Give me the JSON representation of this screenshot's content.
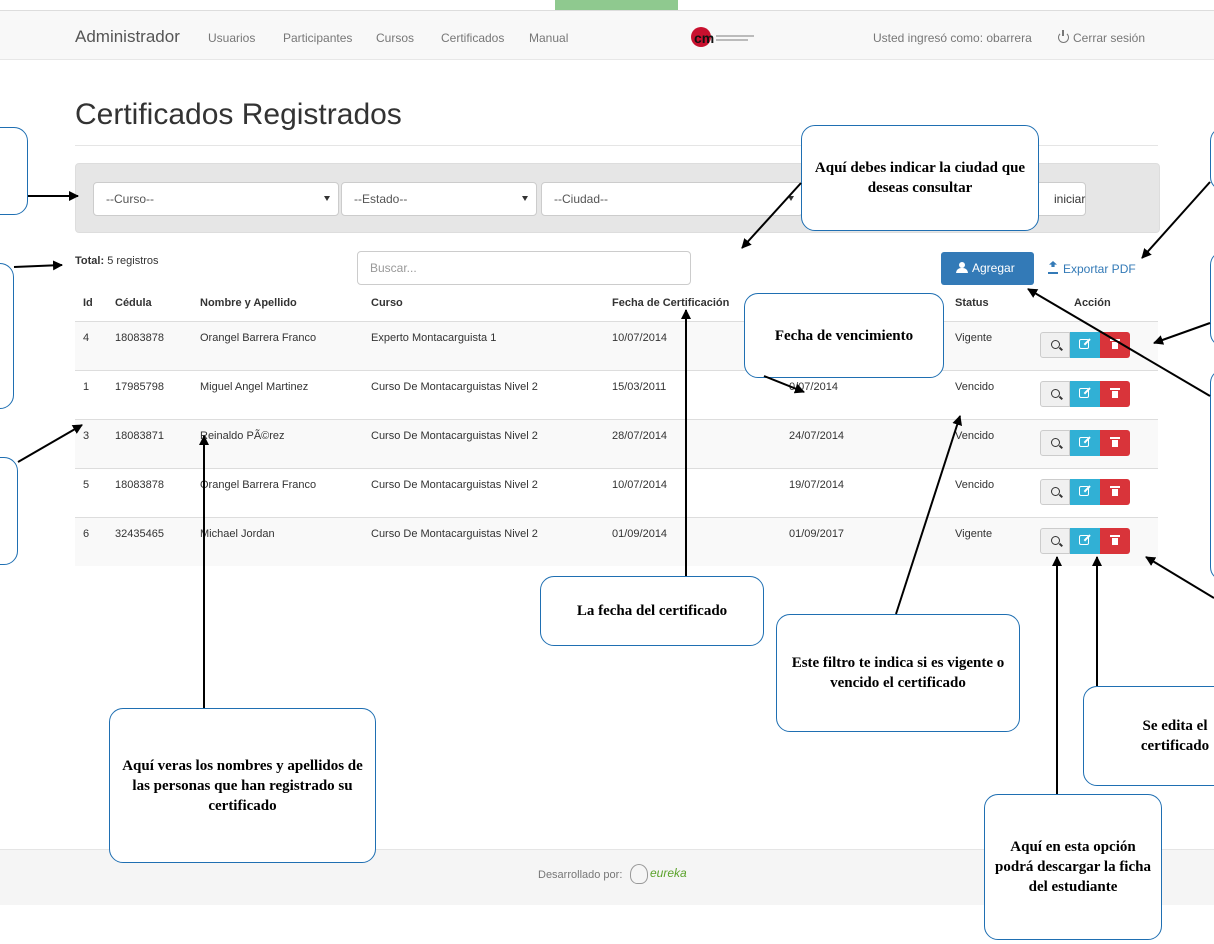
{
  "navbar": {
    "brand": "Administrador",
    "links": [
      "Usuarios",
      "Participantes",
      "Cursos",
      "Certificados",
      "Manual"
    ],
    "logo_text": "cm",
    "user_info": "Usted ingresó como: obarrera",
    "logout": "Cerrar sesión"
  },
  "page": {
    "title": "Certificados Registrados"
  },
  "filters": {
    "curso": "--Curso--",
    "estado": "--Estado--",
    "ciudad": "--Ciudad--",
    "button": "iniciar"
  },
  "toolbar": {
    "total_label": "Total:",
    "total_value": "5 registros",
    "search_placeholder": "Buscar...",
    "add_label": "Agregar",
    "export_label": "Exportar PDF"
  },
  "table": {
    "headers": [
      "Id",
      "Cédula",
      "Nombre y Apellido",
      "Curso",
      "Fecha de Certificación",
      "",
      "Status",
      "Acción"
    ],
    "rows": [
      {
        "id": "4",
        "cedula": "18083878",
        "nombre": "Orangel Barrera Franco",
        "curso": "Experto Montacarguista 1",
        "fecha": "10/07/2014",
        "vence": "",
        "status": "Vigente"
      },
      {
        "id": "1",
        "cedula": "17985798",
        "nombre": "Miguel Angel Martinez",
        "curso": "Curso De Montacarguistas Nivel 2",
        "fecha": "15/03/2011",
        "vence": "0/07/2014",
        "status": "Vencido"
      },
      {
        "id": "3",
        "cedula": "18083871",
        "nombre": "Reinaldo PÃ©rez",
        "curso": "Curso De Montacarguistas Nivel 2",
        "fecha": "28/07/2014",
        "vence": "24/07/2014",
        "status": "Vencido"
      },
      {
        "id": "5",
        "cedula": "18083878",
        "nombre": "Orangel Barrera Franco",
        "curso": "Curso De Montacarguistas Nivel 2",
        "fecha": "10/07/2014",
        "vence": "19/07/2014",
        "status": "Vencido"
      },
      {
        "id": "6",
        "cedula": "32435465",
        "nombre": "Michael Jordan",
        "curso": "Curso De Montacarguistas Nivel 2",
        "fecha": "01/09/2014",
        "vence": "01/09/2017",
        "status": "Vigente"
      }
    ]
  },
  "footer": {
    "text": "Desarrollado por:",
    "brand": "eureka"
  },
  "callouts": {
    "ciudad": "Aquí debes indicar la ciudad que deseas consultar",
    "vencimiento": "Fecha de vencimiento",
    "fecha_cert": "La fecha del certificado",
    "filtro_status": "Este filtro te indica si es vigente o vencido el certificado",
    "nombres": "Aquí veras los nombres y apellidos de las personas que han registrado su certificado",
    "editar": "Se edita el certificado",
    "ficha": "Aquí en esta opción podrá descargar la ficha del estudiante"
  },
  "colors": {
    "primary": "#337ab7",
    "info": "#31b0d5",
    "danger": "#d9343a",
    "callout_border": "#1f6fb2"
  }
}
